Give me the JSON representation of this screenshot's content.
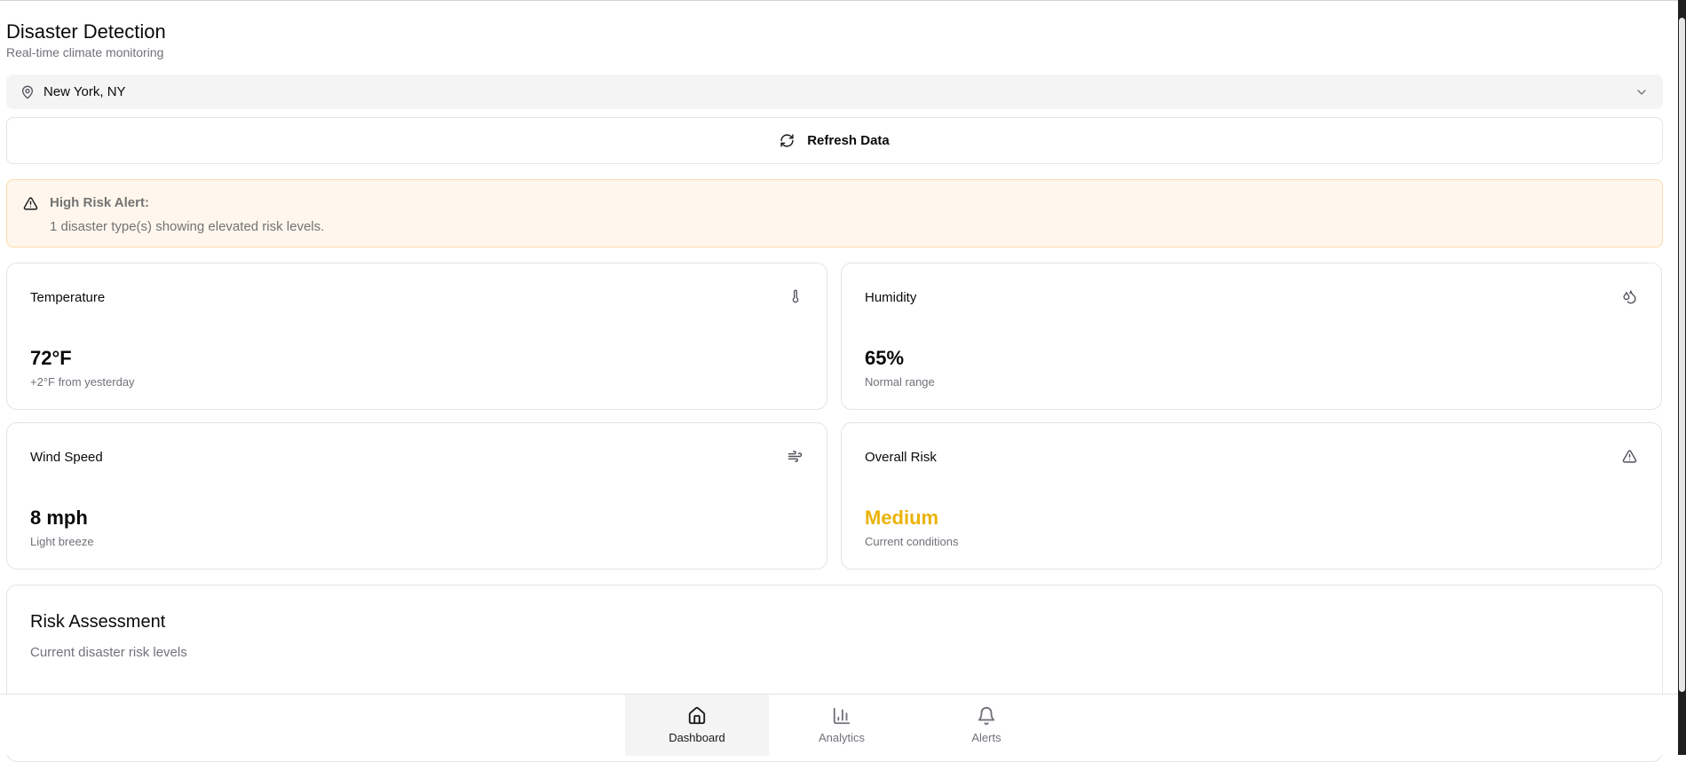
{
  "header": {
    "title": "Disaster Detection",
    "subtitle": "Real-time climate monitoring"
  },
  "location": {
    "selected": "New York, NY",
    "icon": "map-pin-icon"
  },
  "refresh": {
    "label": "Refresh Data",
    "icon": "refresh-icon"
  },
  "alert": {
    "title": "High Risk Alert:",
    "message": "1 disaster type(s) showing elevated risk levels.",
    "icon": "warning-triangle-icon"
  },
  "metrics": {
    "temperature": {
      "title": "Temperature",
      "value": "72°F",
      "note": "+2°F from yesterday",
      "icon": "thermometer-icon"
    },
    "humidity": {
      "title": "Humidity",
      "value": "65%",
      "note": "Normal range",
      "icon": "droplets-icon"
    },
    "wind": {
      "title": "Wind Speed",
      "value": "8 mph",
      "note": "Light breeze",
      "icon": "wind-icon"
    },
    "risk": {
      "title": "Overall Risk",
      "value": "Medium",
      "note": "Current conditions",
      "icon": "warning-triangle-icon",
      "color": "#eab308"
    }
  },
  "risk_assessment": {
    "title": "Risk Assessment",
    "subtitle": "Current disaster risk levels"
  },
  "nav": {
    "items": [
      {
        "label": "Dashboard",
        "icon": "home-icon",
        "active": true
      },
      {
        "label": "Analytics",
        "icon": "bar-chart-icon",
        "active": false
      },
      {
        "label": "Alerts",
        "icon": "bell-icon",
        "active": false
      }
    ]
  }
}
